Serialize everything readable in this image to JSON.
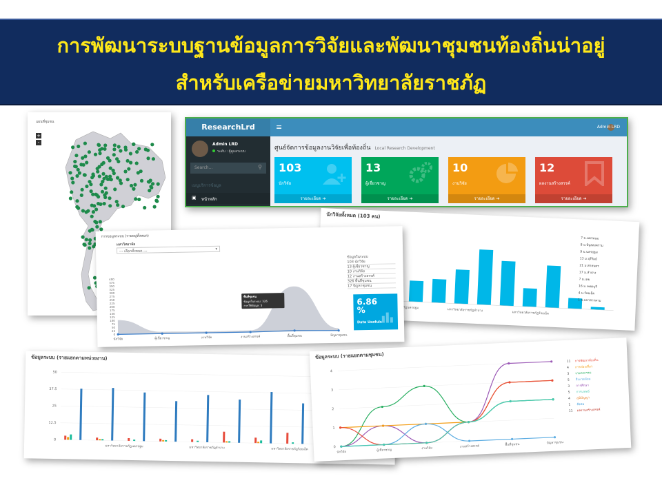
{
  "banner": {
    "line1": "การพัฒนาระบบฐานข้อมูลการวิจัยและพัฒนาชุมชนท้องถิ่นน่าอยู่",
    "line2": "สำหรับเครือข่ายมหาวิทยาลัยราชภัฏ"
  },
  "map": {
    "title": "แผนที่ชุมชน",
    "zoom_in": "+",
    "zoom_out": "-"
  },
  "dashboard": {
    "brand": "ResearchLrd",
    "menu_icon": "≡",
    "user_top": "Admin LRD",
    "user_name": "Admin LRD",
    "user_level": "ระดับ : ผู้ดูแลระบบ",
    "search_placeholder": "Search...",
    "menu_header": "เมนูบริการข้อมูล",
    "menu_home": "หน้าหลัก",
    "page_title": "ศูนย์จัดการข้อมูลงานวิจัยเพื่อท้องถิ่น",
    "page_subtitle": "Local Research Development",
    "boxes": [
      {
        "value": "103",
        "label": "นักวิจัย",
        "more": "รายละเอียด",
        "color": "#00c0ef",
        "icon": "user-plus-icon"
      },
      {
        "value": "13",
        "label": "ผู้เชี่ยวชาญ",
        "more": "รายละเอียด",
        "color": "#00a65a",
        "icon": "gears-icon"
      },
      {
        "value": "10",
        "label": "งานวิจัย",
        "more": "รายละเอียด",
        "color": "#f39c12",
        "icon": "pie-chart-icon"
      },
      {
        "value": "12",
        "label": "ผลงานสร้างสรรค์",
        "more": "รายละเอียด",
        "color": "#dd4b39",
        "icon": "bookmark-icon"
      }
    ]
  },
  "area_panel": {
    "title": "การขอมูลระบบ (รายหมู่ทั้งหมด)",
    "filter_label": "มหาวิทยาลัย",
    "filter_value": "--- เลือกทั้งหมด ---",
    "legend_title": "ข้อมูลในระบบ",
    "legend": [
      {
        "count": "103",
        "name": "นักวิจัย"
      },
      {
        "count": "13",
        "name": "ผู้เชี่ยวชาญ"
      },
      {
        "count": "10",
        "name": "งานวิจัย"
      },
      {
        "count": "12",
        "name": "งานสร้างสรรค์"
      },
      {
        "count": "326",
        "name": "พื้นที่ชุมชน"
      },
      {
        "count": "17",
        "name": "ปัญหาชุมชน"
      }
    ],
    "tooltip": {
      "title": "พื้นที่ชุมชน",
      "row1": "ข้อมูลในระบบ: 326",
      "row2": "การใช้ข้อมูล: 5"
    },
    "stat_value": "6.86 %",
    "stat_label": "Data Usefuls",
    "colors": {
      "area": "#c8cbd4",
      "line": "#3a7dc9",
      "stat": "#00a7e0"
    }
  },
  "bar_panel": {
    "title": "นักวิจัยทั้งหมด (103 คน)",
    "legend": [
      {
        "count": "7",
        "name": "ม.นครพนม"
      },
      {
        "count": "8",
        "name": "ม.พิบูลสงคราม"
      },
      {
        "count": "9",
        "name": "ม.นครปฐม"
      },
      {
        "count": "13",
        "name": "ม.บุรีรัมย์"
      },
      {
        "count": "21",
        "name": "ม.สกลนคร"
      },
      {
        "count": "17",
        "name": "ม.ลำปาง"
      },
      {
        "count": "7",
        "name": "ม.เลย"
      },
      {
        "count": "16",
        "name": "ม.เพชรบุรี"
      },
      {
        "count": "4",
        "name": "ม.ร้อยเอ็ด"
      },
      {
        "count": "1",
        "name": "ม.มหาสารคาม"
      }
    ],
    "color": "#00b7e8"
  },
  "group_panel": {
    "title": "ข้อมูลระบบ (รายแยกตามหน่วยงาน)"
  },
  "line_panel": {
    "title": "ข้อมูลระบบ (รายแยกตามชุมชน)",
    "legend": [
      {
        "count": "11",
        "name": "การพัฒนาท้องถิ่น"
      },
      {
        "count": "4",
        "name": "การท่องเที่ยว"
      },
      {
        "count": "3",
        "name": "เกษตรกรรม"
      },
      {
        "count": "5",
        "name": "สิ่งแวดล้อม"
      },
      {
        "count": "3",
        "name": "การศึกษา"
      },
      {
        "count": "5",
        "name": "การแพทย์"
      },
      {
        "count": "4",
        "name": "ภูมิปัญญา"
      },
      {
        "count": "1",
        "name": "สังคม"
      },
      {
        "count": "11",
        "name": "ผลงานสร้างสรรค์"
      }
    ]
  },
  "chart_data": [
    {
      "type": "area",
      "title": "การขอมูลระบบ (รายหมู่ทั้งหมด)",
      "categories": [
        "นักวิจัย",
        "ผู้เชี่ยวชาญ",
        "งานวิจัย",
        "งานสร้างสรรค์",
        "พื้นที่ชุมชน",
        "ปัญหาชุมชน"
      ],
      "series": [
        {
          "name": "ข้อมูลในระบบ",
          "values": [
            103,
            13,
            10,
            12,
            326,
            17
          ]
        },
        {
          "name": "การใช้ข้อมูล",
          "values": [
            0,
            0,
            0,
            0,
            5,
            0
          ]
        }
      ],
      "ylim": [
        0,
        400
      ],
      "yticks": [
        0,
        25,
        50,
        75,
        100,
        125,
        150,
        175,
        200,
        225,
        250,
        275,
        300,
        325,
        350,
        375,
        400
      ]
    },
    {
      "type": "bar",
      "title": "นักวิจัยทั้งหมด (103 คน)",
      "categories": [
        "มหาวิทยาลัยราชภัฏนครปฐม",
        "มหาวิทยาลัยราชภัฏลำปาง",
        "มหาวิทยาลัยราชภัฏร้อยเอ็ด"
      ],
      "values": [
        7,
        8,
        9,
        13,
        21,
        17,
        7,
        16,
        4,
        1
      ]
    },
    {
      "type": "bar",
      "title": "ข้อมูลระบบ (รายแยกตามหน่วยงาน)",
      "ylim": [
        0,
        50
      ],
      "yticks": [
        0,
        12.5,
        25,
        37.5,
        50
      ],
      "categories": [
        "มหาวิทยาลัยราชภัฏนครปฐม",
        "มหาวิทยาลัยราชภัฏลำปาง",
        "มหาวิทยาลัยราชภัฏร้อยเอ็ด"
      ],
      "series": [
        {
          "name": "",
          "color": "#e74c3c",
          "values": [
            3,
            2,
            2,
            2,
            2,
            8,
            4,
            8,
            4,
            3
          ]
        },
        {
          "name": "",
          "color": "#f39c12",
          "values": [
            2,
            1,
            0,
            1,
            0,
            1,
            1,
            0,
            1,
            1
          ]
        },
        {
          "name": "",
          "color": "#1abc9c",
          "values": [
            4,
            1,
            1,
            1,
            1,
            1,
            2,
            1,
            1,
            1
          ]
        },
        {
          "name": "",
          "color": "#2e7bbf",
          "values": [
            38,
            39,
            36,
            30,
            35,
            32,
            38,
            30,
            30,
            28
          ]
        }
      ]
    },
    {
      "type": "line",
      "title": "ข้อมูลระบบ (รายแยกตามชุมชน)",
      "categories": [
        "นักวิจัย",
        "ผู้เชี่ยวชาญ",
        "งานวิจัย",
        "งานสร้างสรรค์",
        "พื้นที่ชุมชน",
        "ปัญหาชุมชน"
      ],
      "ylim": [
        0,
        4
      ],
      "series": [
        {
          "name": "",
          "color": "#27ae60",
          "values": [
            0,
            2,
            3,
            1,
            2,
            2
          ]
        },
        {
          "name": "",
          "color": "#9b59b6",
          "values": [
            0,
            1,
            0,
            1,
            4,
            4
          ]
        },
        {
          "name": "",
          "color": "#f39c12",
          "values": [
            1,
            1,
            1,
            1,
            3,
            3
          ]
        },
        {
          "name": "",
          "color": "#5dade2",
          "values": [
            0,
            0,
            1,
            0,
            0,
            0
          ]
        },
        {
          "name": "",
          "color": "#e74c3c",
          "values": [
            1,
            0,
            0,
            1,
            3,
            3
          ]
        },
        {
          "name": "",
          "color": "#48c9b0",
          "values": [
            0,
            0,
            0,
            1,
            2,
            2
          ]
        }
      ]
    }
  ]
}
